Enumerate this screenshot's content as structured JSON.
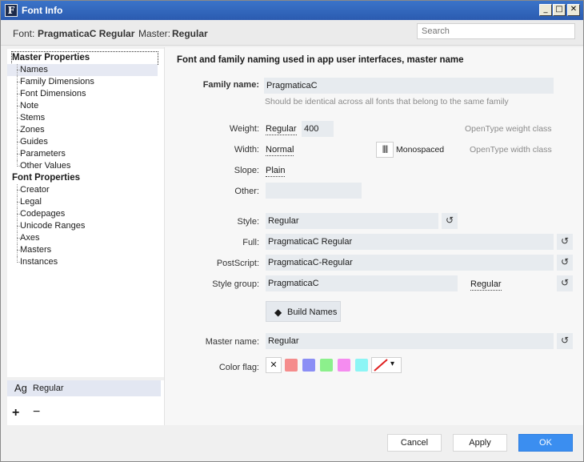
{
  "window": {
    "title": "Font Info",
    "app_icon_letter": "F",
    "controls": {
      "minimize": "_",
      "maximize": "□",
      "close": "✕"
    }
  },
  "header": {
    "font_label": "Font:",
    "font_value": "PragmaticaC Regular",
    "master_label": "Master:",
    "master_value": "Regular",
    "search_placeholder": "Search"
  },
  "sidebar": {
    "master_properties": {
      "label": "Master Properties",
      "items": [
        "Names",
        "Family Dimensions",
        "Font Dimensions",
        "Note",
        "Stems",
        "Zones",
        "Guides",
        "Parameters",
        "Other Values"
      ]
    },
    "font_properties": {
      "label": "Font Properties",
      "items": [
        "Creator",
        "Legal",
        "Codepages",
        "Unicode Ranges",
        "Axes",
        "Masters",
        "Instances"
      ]
    },
    "selected_item": "Names"
  },
  "masters_list": {
    "items": [
      {
        "preview": "Ag",
        "name": "Regular"
      }
    ],
    "add_label": "+",
    "remove_label": "−"
  },
  "main": {
    "section_title": "Font and family naming used in app user interfaces, master name",
    "family_name": {
      "label": "Family name:",
      "value": "PragmaticaC",
      "hint": "Should be identical across all fonts that belong to the same family"
    },
    "weight": {
      "label": "Weight:",
      "link": "Regular",
      "value": "400",
      "hint": "OpenType weight class"
    },
    "width": {
      "label": "Width:",
      "link": "Normal",
      "hint": "OpenType width class"
    },
    "monospaced": {
      "icon": "||||",
      "label": "Monospaced",
      "checked": false
    },
    "slope": {
      "label": "Slope:",
      "link": "Plain"
    },
    "other": {
      "label": "Other:",
      "value": ""
    },
    "style": {
      "label": "Style:",
      "value": "Regular"
    },
    "full": {
      "label": "Full:",
      "value": "PragmaticaC Regular"
    },
    "postscript": {
      "label": "PostScript:",
      "value": "PragmaticaC-Regular"
    },
    "style_group": {
      "label": "Style group:",
      "value": "PragmaticaC",
      "link": "Regular"
    },
    "build_names": {
      "icon": "◆",
      "label": "Build Names"
    },
    "master_name": {
      "label": "Master name:",
      "value": "Regular"
    },
    "color_flag": {
      "label": "Color flag:",
      "none_symbol": "✕",
      "dropdown_arrow": "▾",
      "colors": [
        "#f58c8c",
        "#8b8ef5",
        "#8cf08c",
        "#f58cf0",
        "#8cf5f5"
      ]
    },
    "reset_symbol": "↺"
  },
  "footer": {
    "cancel": "Cancel",
    "apply": "Apply",
    "ok": "OK"
  }
}
